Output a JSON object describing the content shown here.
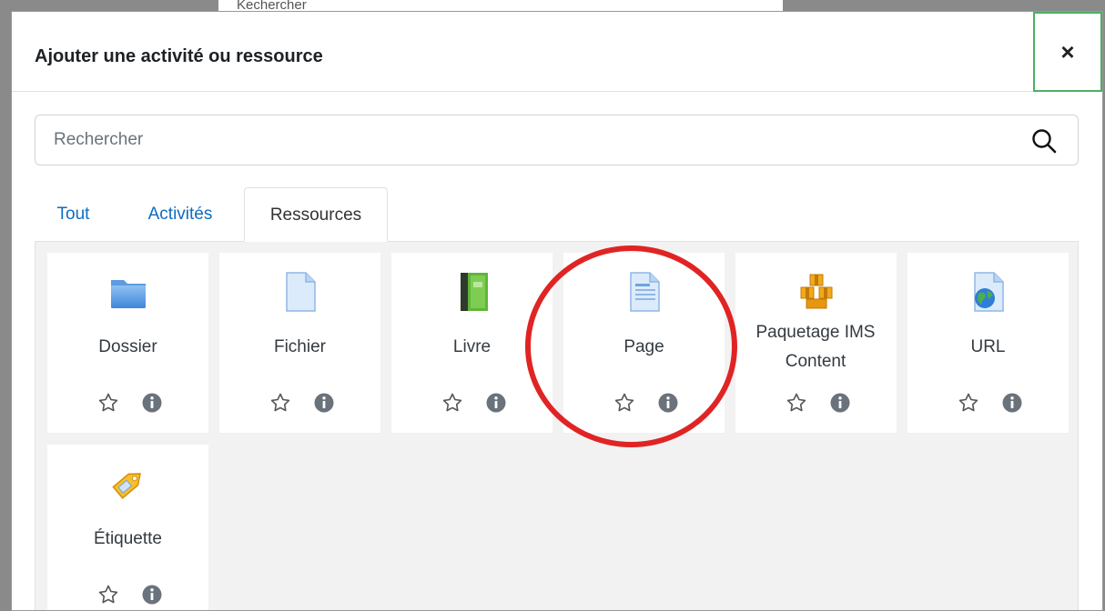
{
  "background": {
    "text": "Kechercher"
  },
  "modal": {
    "title": "Ajouter une activité ou ressource",
    "close_label": "×"
  },
  "search": {
    "placeholder": "Rechercher",
    "value": ""
  },
  "tabs": [
    {
      "label": "Tout",
      "active": false
    },
    {
      "label": "Activités",
      "active": false
    },
    {
      "label": "Ressources",
      "active": true
    }
  ],
  "cards": [
    {
      "label": "Dossier",
      "icon": "folder-icon"
    },
    {
      "label": "Fichier",
      "icon": "file-icon"
    },
    {
      "label": "Livre",
      "icon": "book-icon"
    },
    {
      "label": "Page",
      "icon": "page-icon"
    },
    {
      "label": "Paquetage IMS Content",
      "icon": "ims-package-icon"
    },
    {
      "label": "URL",
      "icon": "url-icon"
    },
    {
      "label": "Étiquette",
      "icon": "label-tag-icon"
    }
  ],
  "colors": {
    "accent_link": "#0f6cbf",
    "close_focus": "#4caf63",
    "highlight_ring": "#e02424",
    "content_bg": "#f2f2f2"
  }
}
